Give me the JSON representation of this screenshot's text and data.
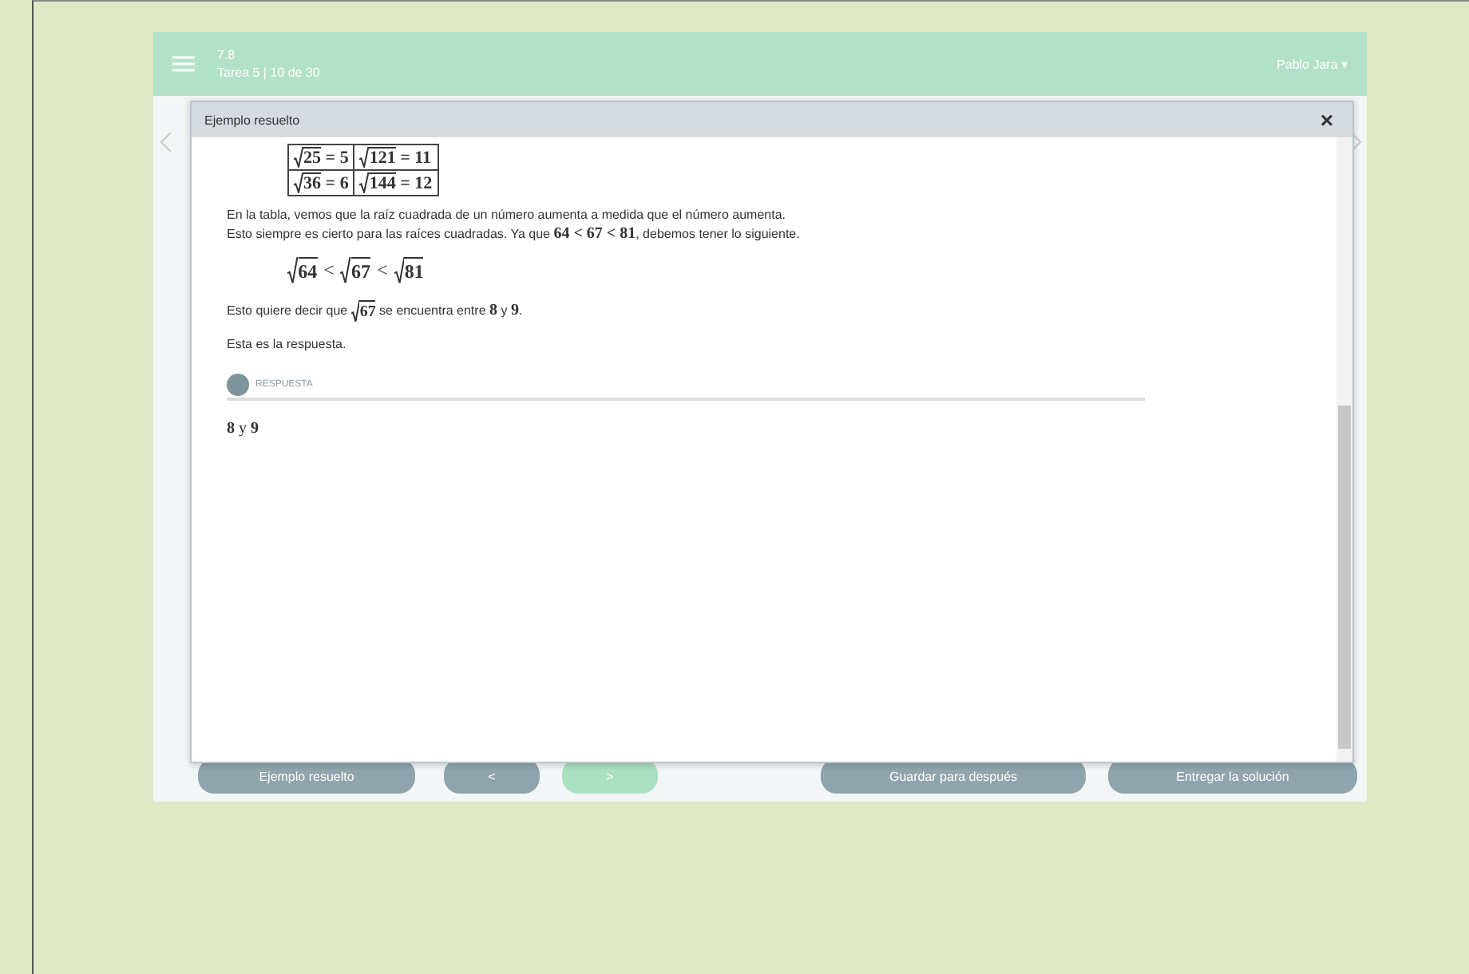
{
  "header": {
    "score": "7.8",
    "subtitle": "Tarea 5 | 10 de 30",
    "user": "Pablo Jara ▾"
  },
  "modal": {
    "title": "Ejemplo resuelto",
    "close": "×",
    "table": [
      [
        {
          "radicand": "25",
          "result": "= 5"
        },
        {
          "radicand": "121",
          "result": "= 11"
        }
      ],
      [
        {
          "radicand": "36",
          "result": "= 6"
        },
        {
          "radicand": "144",
          "result": "= 12"
        }
      ]
    ],
    "paragraph": "En la tabla, vemos que la raíz cuadrada de un número aumenta a medida que el número aumenta.\nEsto siempre es cierto para las raíces cuadradas. Ya que **64 < 67 < 81**, debemos tener lo siguiente.",
    "inequality": [
      {
        "kind": "sqrt",
        "text": "64"
      },
      {
        "kind": "op",
        "text": "<"
      },
      {
        "kind": "sqrt",
        "text": "67"
      },
      {
        "kind": "op",
        "text": "<"
      },
      {
        "kind": "sqrt",
        "text": "81"
      }
    ],
    "conclusion": [
      {
        "kind": "text",
        "text": "Esto quiere decir que "
      },
      {
        "kind": "sqrt",
        "text": "67"
      },
      {
        "kind": "text",
        "text": " se encuentra entre **8** y **9**."
      }
    ],
    "closing": "Esta es la respuesta.",
    "answer_label": "RESPUESTA",
    "answer": "**8** y **9**"
  },
  "buttons": [
    {
      "label": "Ejemplo resuelto",
      "kind": "grey"
    },
    {
      "label": "<",
      "kind": "grey"
    },
    {
      "label": ">",
      "kind": "green"
    },
    {
      "label": "Guardar para después",
      "kind": "grey"
    },
    {
      "label": "Entregar la solución",
      "kind": "grey"
    }
  ]
}
